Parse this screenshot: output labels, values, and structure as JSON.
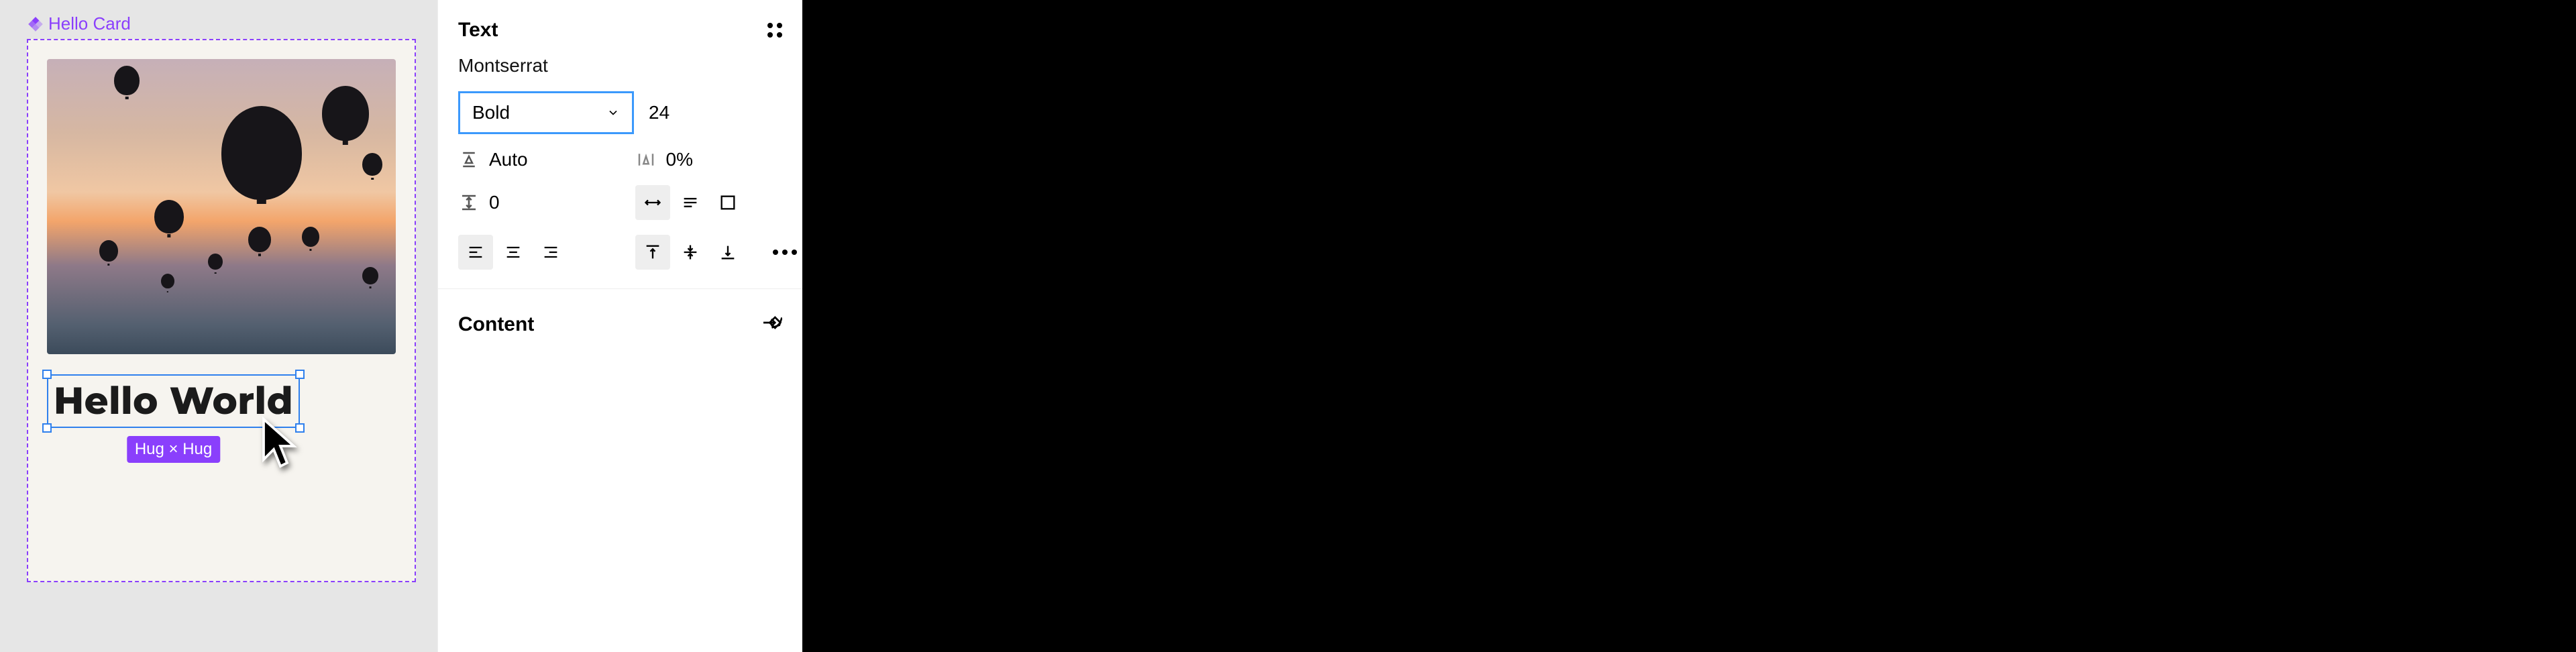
{
  "canvas": {
    "component_name": "Hello Card",
    "text_content": "Hello World",
    "size_badge": "Hug × Hug"
  },
  "panel": {
    "section_title": "Text",
    "font_family": "Montserrat",
    "font_weight": "Bold",
    "font_size": "24",
    "line_height_label": "Auto",
    "letter_spacing_label": "0%",
    "paragraph_spacing": "0",
    "content_section_title": "Content"
  }
}
